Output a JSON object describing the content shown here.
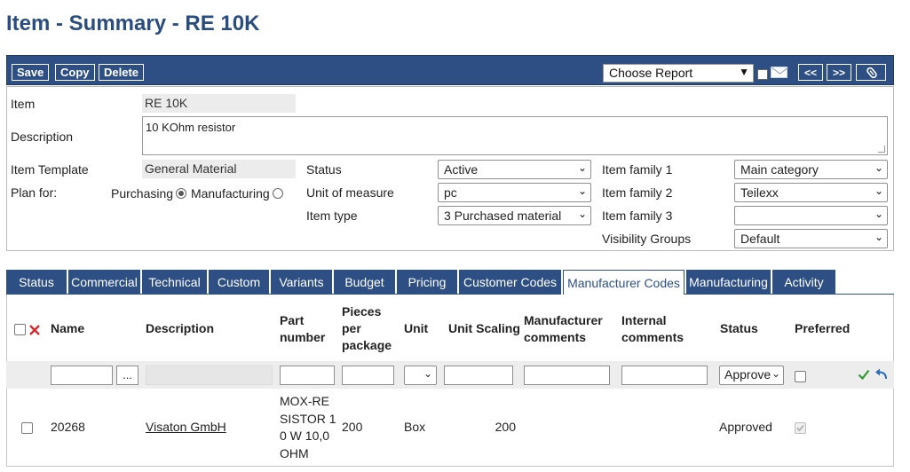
{
  "page": {
    "title": "Item - Summary - RE 10K"
  },
  "toolbar": {
    "save_label": "Save",
    "copy_label": "Copy",
    "delete_label": "Delete",
    "report_select_value": "Choose Report",
    "prev_label": "<<",
    "next_label": ">>"
  },
  "form": {
    "item_label": "Item",
    "item_value": "RE 10K",
    "description_label": "Description",
    "description_value": "10 KOhm resistor",
    "template_label": "Item Template",
    "template_value": "General Material",
    "plan_for_label": "Plan for:",
    "purchasing_label": "Purchasing",
    "manufacturing_label": "Manufacturing",
    "status_label": "Status",
    "status_value": "Active",
    "uom_label": "Unit of measure",
    "uom_value": "pc",
    "item_type_label": "Item type",
    "item_type_value": "3 Purchased material",
    "family1_label": "Item family 1",
    "family1_value": "Main category",
    "family2_label": "Item family 2",
    "family2_value": "Teilexx",
    "family3_label": "Item family 3",
    "family3_value": "",
    "visibility_label": "Visibility Groups",
    "visibility_value": "Default"
  },
  "tabs": [
    {
      "label": "Status"
    },
    {
      "label": "Commercial"
    },
    {
      "label": "Technical"
    },
    {
      "label": "Custom"
    },
    {
      "label": "Variants"
    },
    {
      "label": "Budget"
    },
    {
      "label": "Pricing"
    },
    {
      "label": "Customer Codes"
    },
    {
      "label": "Manufacturer Codes"
    },
    {
      "label": "Manufacturing"
    },
    {
      "label": "Activity"
    }
  ],
  "table": {
    "headers": {
      "name": "Name",
      "description": "Description",
      "part_number_1": "Part",
      "part_number_2": "number",
      "pieces_1": "Pieces",
      "pieces_2": "per",
      "pieces_3": "package",
      "unit": "Unit",
      "unit_scaling": "Unit Scaling",
      "mfr_comments_1": "Manufacturer",
      "mfr_comments_2": "comments",
      "int_comments_1": "Internal",
      "int_comments_2": "comments",
      "status": "Status",
      "preferred": "Preferred"
    },
    "filter": {
      "browse_label": "...",
      "status_value": "Approve"
    },
    "rows": [
      {
        "name": "20268",
        "description": "Visaton GmbH",
        "part_line1": "MOX-RE",
        "part_line2": "SISTOR 1",
        "part_line3": "0 W 10,0",
        "part_line4": "OHM",
        "pieces": "200",
        "unit": "Box",
        "unit_scaling": "200",
        "mfr_comments": "",
        "int_comments": "",
        "status": "Approved"
      }
    ]
  },
  "colors": {
    "header_blue": "#2d4f84",
    "title_blue": "#2a4d7f",
    "delete_red": "#d9262b",
    "confirm_green": "#2e9a2e"
  }
}
